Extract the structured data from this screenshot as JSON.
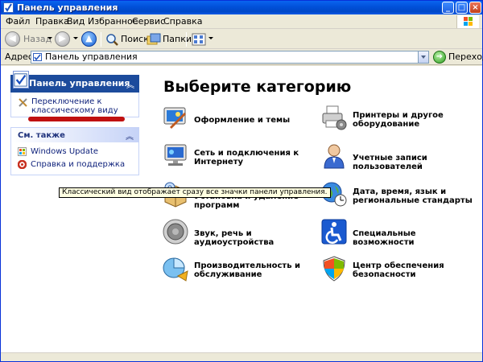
{
  "window": {
    "title": "Панель управления",
    "minimize_glyph": "_",
    "maximize_glyph": "□",
    "close_glyph": "×"
  },
  "menu": [
    "Файл",
    "Правка",
    "Вид",
    "Избранное",
    "Сервис",
    "Справка"
  ],
  "toolbar": {
    "back_label": "Назад",
    "search_label": "Поиск",
    "folders_label": "Папки"
  },
  "address": {
    "label": "Адрес:",
    "value": "Панель управления",
    "go_label": "Переход"
  },
  "sidebar": {
    "panel1": {
      "title": "Панель управления",
      "link_line1": "Переключение к",
      "link_line2": "классическому виду"
    },
    "panel2": {
      "title": "См. также",
      "items": [
        {
          "label": "Windows Update",
          "icon": "windows-update-icon"
        },
        {
          "label": "Справка и поддержка",
          "icon": "help-support-icon"
        }
      ]
    }
  },
  "tooltip": "Классический вид отображает сразу все значки панели управления.",
  "main": {
    "heading": "Выберите категорию",
    "categories": [
      {
        "line1": "Оформление и темы",
        "line2": "",
        "icon": "appearance-themes-icon"
      },
      {
        "line1": "Принтеры и другое",
        "line2": "оборудование",
        "icon": "printers-hardware-icon"
      },
      {
        "line1": "Сеть и подключения к",
        "line2": "Интернету",
        "icon": "network-connections-icon"
      },
      {
        "line1": "Учетные записи пользователей",
        "line2": "",
        "icon": "user-accounts-icon"
      },
      {
        "line1": "Установка и удаление программ",
        "line2": "",
        "icon": "add-remove-programs-icon"
      },
      {
        "line1": "Дата, время, язык и",
        "line2": "региональные стандарты",
        "icon": "date-time-language-icon"
      },
      {
        "line1": "Звук, речь и аудиоустройства",
        "line2": "",
        "icon": "sounds-audio-icon"
      },
      {
        "line1": "Специальные возможности",
        "line2": "",
        "icon": "accessibility-icon"
      },
      {
        "line1": "Производительность и",
        "line2": "обслуживание",
        "icon": "performance-maintenance-icon"
      },
      {
        "line1": "Центр обеспечения",
        "line2": "безопасности",
        "icon": "security-center-icon"
      }
    ]
  },
  "colors": {
    "title_bar": "#0150d8",
    "task_header": "#1c4b9c",
    "link_text": "#0c1f7a",
    "highlight_mark": "#c01010"
  }
}
